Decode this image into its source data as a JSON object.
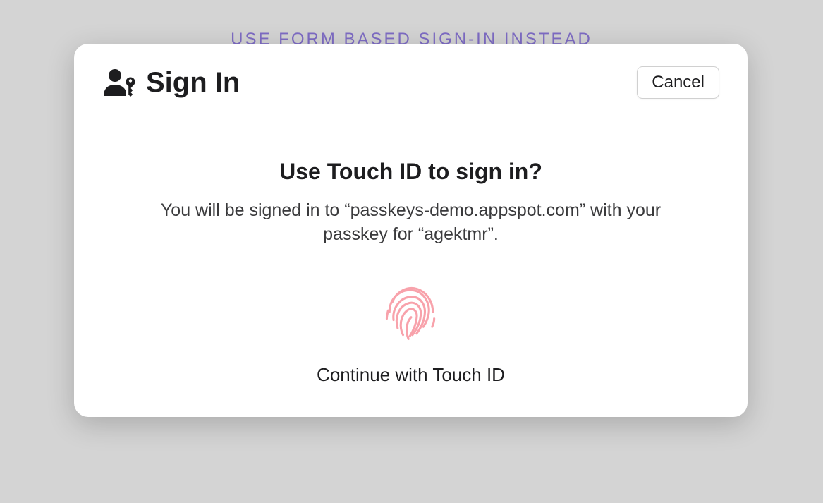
{
  "background": {
    "link_text": "USE FORM BASED SIGN-IN INSTEAD"
  },
  "modal": {
    "title": "Sign In",
    "cancel_label": "Cancel",
    "prompt_title": "Use Touch ID to sign in?",
    "prompt_description": "You will be signed in to “passkeys-demo.appspot.com” with your passkey for “agektmr”.",
    "continue_label": "Continue with Touch ID"
  },
  "colors": {
    "link": "#7e6cc4",
    "fingerprint": "#f8a2ab"
  }
}
